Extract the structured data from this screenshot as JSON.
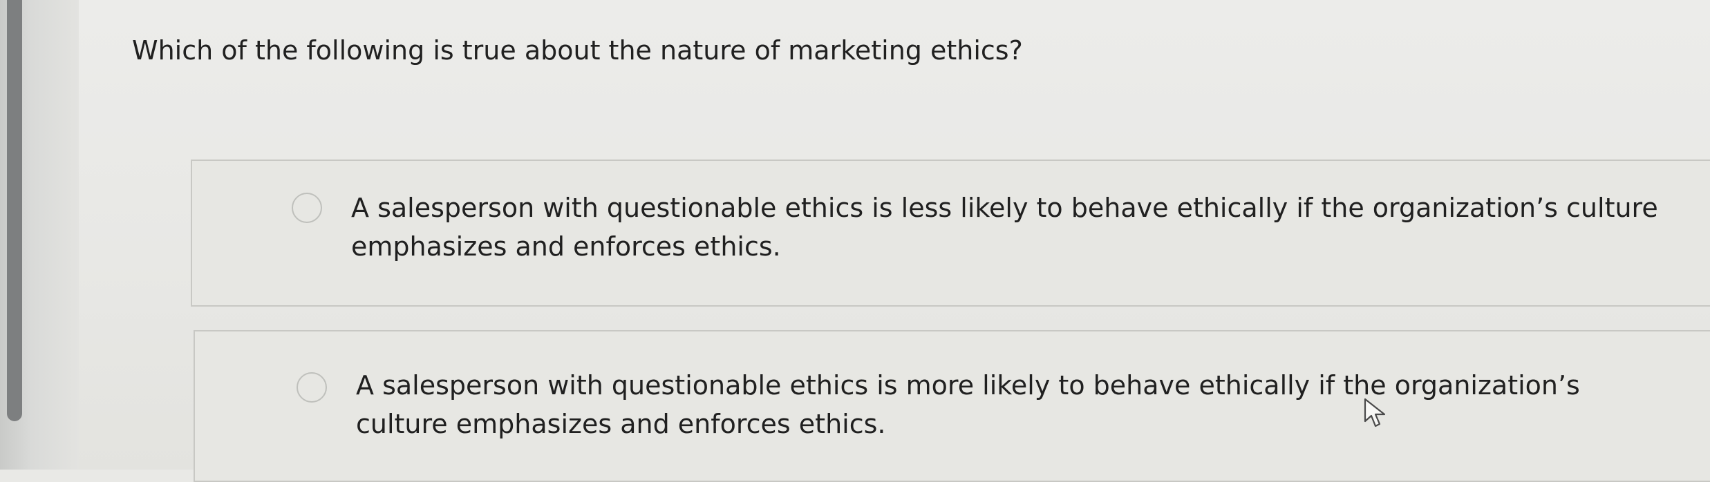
{
  "question": {
    "text": "Which of the following is true about the nature of marketing ethics?"
  },
  "options": [
    {
      "text": "A salesperson with questionable ethics is less likely to behave ethically if the organization’s culture emphasizes and enforces ethics.",
      "selected": false
    },
    {
      "text": "A salesperson with questionable ethics is more likely to behave ethically if the organization’s culture emphasizes and enforces ethics.",
      "selected": false
    }
  ],
  "icons": {
    "radio": "radio-circle-icon",
    "cursor": "mouse-pointer-icon"
  },
  "colors": {
    "background": "#e9e9e6",
    "text": "#202020",
    "option_border": "#c8c8c4",
    "scrollbar": "#7d7f80"
  }
}
